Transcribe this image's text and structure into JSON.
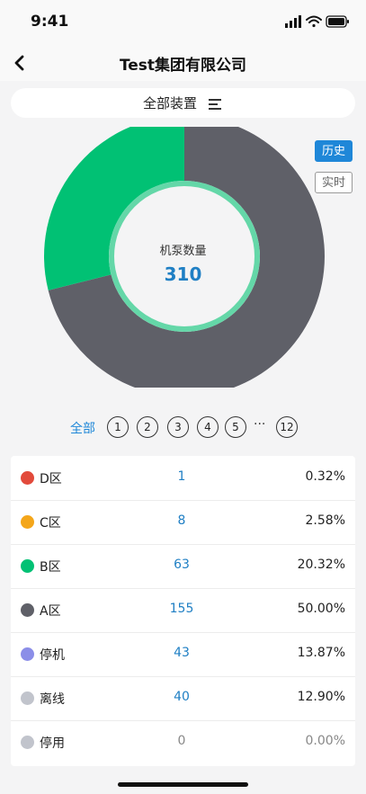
{
  "status_bar": {
    "time": "9:41"
  },
  "nav": {
    "title": "Test集团有限公司"
  },
  "device_selector": {
    "label": "全部装置"
  },
  "toggles": {
    "history": "历史",
    "realtime": "实时"
  },
  "colors": {
    "green": "#01c174",
    "gray": "#5f6068",
    "light_green_ring": "#64d7a8",
    "accent_blue": "#1f87d8"
  },
  "chart_data": {
    "type": "pie",
    "center_label": "机泵数量",
    "total": "310",
    "slices": [
      {
        "name": "A区",
        "value": 155,
        "color": "#5f6068"
      },
      {
        "name": "B区",
        "value": 63,
        "color": "#01c174"
      }
    ]
  },
  "pager": {
    "all_label": "全部",
    "pages": [
      "1",
      "2",
      "3",
      "4",
      "5"
    ],
    "ellipsis": "···",
    "last_page": "12"
  },
  "legend": [
    {
      "name": "D区",
      "count": "1",
      "percent": "0.32%",
      "color": "#e24a3b"
    },
    {
      "name": "C区",
      "count": "8",
      "percent": "2.58%",
      "color": "#f4a61a"
    },
    {
      "name": "B区",
      "count": "63",
      "percent": "20.32%",
      "color": "#01c174"
    },
    {
      "name": "A区",
      "count": "155",
      "percent": "50.00%",
      "color": "#5f6068"
    },
    {
      "name": "停机",
      "count": "43",
      "percent": "13.87%",
      "color": "#8b8ee8"
    },
    {
      "name": "离线",
      "count": "40",
      "percent": "12.90%",
      "color": "#c1c4cc"
    },
    {
      "name": "停用",
      "count": "0",
      "percent": "0.00%",
      "color": "#c1c4cc"
    }
  ]
}
